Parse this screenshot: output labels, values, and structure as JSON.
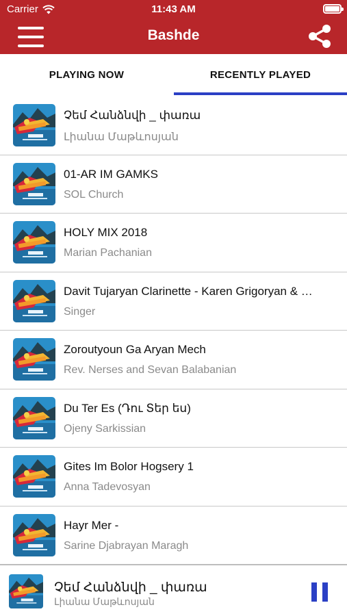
{
  "status_bar": {
    "carrier": "Carrier",
    "time": "11:43 AM"
  },
  "nav": {
    "title": "Bashde",
    "menu_icon": "hamburger-menu-icon",
    "share_icon": "share-icon"
  },
  "tabs": [
    {
      "label": "PLAYING NOW",
      "active": false
    },
    {
      "label": "RECENTLY PLAYED",
      "active": true
    }
  ],
  "tracks": [
    {
      "title": "Չեմ Հանձնվի _ փառա",
      "artist": "Լիանա Մաթևոսյան"
    },
    {
      "title": "01-AR IM GAMKS",
      "artist": "SOL Church"
    },
    {
      "title": " HOLY MIX 2018",
      "artist": "Marian Pachanian"
    },
    {
      "title": "Davit Tujaryan Clarinette - Karen Grigoryan & Gohar",
      "artist": "Singer"
    },
    {
      "title": "Zoroutyoun Ga Aryan Mech",
      "artist": "Rev. Nerses and Sevan Balabanian"
    },
    {
      "title": "Du Ter Es (Դու Տեր ես)",
      "artist": " Ojeny Sarkissian"
    },
    {
      "title": "Gites Im Bolor Hogsery 1",
      "artist": "Anna Tadevosyan"
    },
    {
      "title": "Hayr Mer - ",
      "artist": "Sarine Djabrayan Maragh"
    }
  ],
  "player": {
    "title": "Չեմ Հանձնվի _ փառա",
    "artist": "Լիանա Մաթևոսյան",
    "state_icon": "pause-icon"
  },
  "colors": {
    "header": "#b8262a",
    "accent": "#2b40c5",
    "subtitle": "#8a8a8a",
    "divider": "#c8c8c8"
  }
}
